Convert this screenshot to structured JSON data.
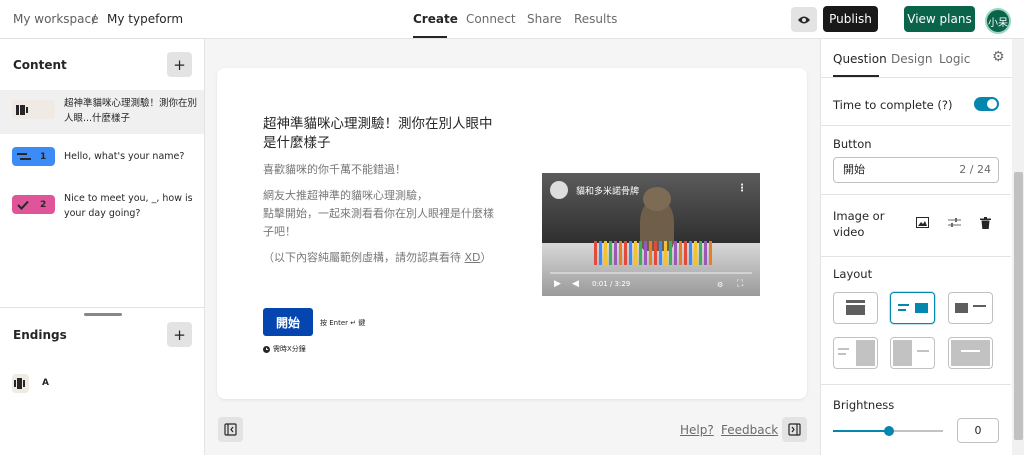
{
  "header": {
    "breadcrumb_workspace": "My workspace",
    "breadcrumb_sep": "/",
    "breadcrumb_form": "My typeform",
    "tabs": [
      {
        "label": "Create",
        "active": true
      },
      {
        "label": "Connect",
        "active": false
      },
      {
        "label": "Share",
        "active": false
      },
      {
        "label": "Results",
        "active": false
      }
    ],
    "publish_label": "Publish",
    "plans_label": "View plans",
    "avatar_text": "小呆"
  },
  "left_panel": {
    "content_title": "Content",
    "questions": [
      {
        "number": "",
        "text": "超神準貓咪心理測驗！測你在別人眼...什麼樣子",
        "badge_color": "#efeae3",
        "icon": "welcome-screen-icon"
      },
      {
        "number": "1",
        "text": "Hello, what's your name?",
        "badge_color": "#3d8bf7",
        "icon": "short-text-icon"
      },
      {
        "number": "2",
        "text": "Nice to meet you, _, how is your day going?",
        "badge_color": "#e0559a",
        "icon": "checkmark-icon"
      }
    ],
    "endings_title": "Endings",
    "ending_label": "A"
  },
  "canvas": {
    "title": "超神準貓咪心理測驗！測你在別人眼中是什麼樣子",
    "line1": "喜歡貓咪的你千萬不能錯過！",
    "line2": "網友大推超神準的貓咪心理測驗，",
    "line3": "點擊開始，一起來測看看你在別人眼裡是什麼樣子吧！",
    "line4_pre": "（以下內容純屬範例虛構，請勿認真看待 ",
    "line4_link": "XD",
    "line4_post": "）",
    "start_label": "開始",
    "enter_hint": "按 Enter ↵ 鍵",
    "time_hint": "需時X分鐘",
    "video_title": "貓和多米諾骨牌",
    "video_time": "0:01 / 3:29"
  },
  "footer": {
    "help": "Help?",
    "feedback": "Feedback"
  },
  "right_panel": {
    "tabs": [
      {
        "label": "Question",
        "active": true
      },
      {
        "label": "Design",
        "active": false
      },
      {
        "label": "Logic",
        "active": false
      }
    ],
    "time_to_complete": "Time to complete (?)",
    "time_to_complete_on": true,
    "button_label": "Button",
    "button_value": "開始",
    "button_count": "2 / 24",
    "image_or_video": "Image or",
    "image_or_video_2": "video",
    "layout_label": "Layout",
    "brightness_label": "Brightness",
    "brightness_value": "0",
    "accent_color": "#0487af"
  }
}
